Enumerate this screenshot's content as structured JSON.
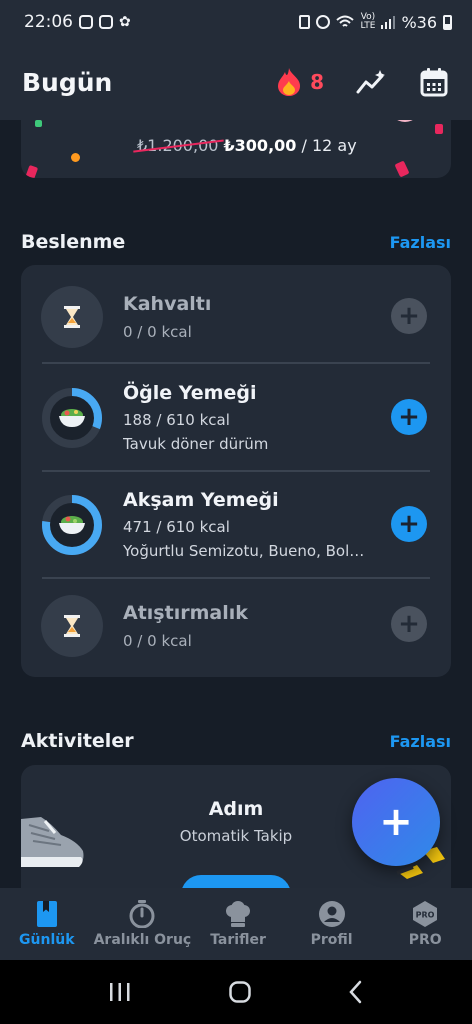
{
  "status_bar": {
    "time": "22:06",
    "battery_text": "%36"
  },
  "header": {
    "title": "Bugün",
    "streak_count": "8"
  },
  "promo": {
    "old_price": "₺1.200,00",
    "new_price": "₺300,00",
    "period": " / 12 ay"
  },
  "nutrition": {
    "title": "Beslenme",
    "more_link": "Fazlası",
    "meals": [
      {
        "name": "Kahvaltı",
        "kcal": "0 / 0 kcal",
        "detail": "",
        "icon": "hourglass-icon",
        "progress": 0
      },
      {
        "name": "Öğle Yemeği",
        "kcal": "188 / 610 kcal",
        "detail": "Tavuk döner dürüm",
        "icon": "salad-bowl-icon",
        "progress": 0.31
      },
      {
        "name": "Akşam Yemeği",
        "kcal": "471 / 610 kcal",
        "detail": "Yoğurtlu Semizotu, Bueno, Bolo…",
        "icon": "salad-bowl-icon",
        "progress": 0.77
      },
      {
        "name": "Atıştırmalık",
        "kcal": "0 / 0 kcal",
        "detail": "",
        "icon": "hourglass-icon",
        "progress": 0
      }
    ]
  },
  "activities": {
    "title": "Aktiviteler",
    "more_link": "Fazlası",
    "card_title": "Adım",
    "card_subtitle": "Otomatik Takip"
  },
  "bottom_nav": {
    "items": [
      {
        "label": "Günlük",
        "icon": "diary-icon",
        "active": true
      },
      {
        "label": "Aralıklı Oruç",
        "icon": "stopwatch-icon",
        "active": false
      },
      {
        "label": "Tarifler",
        "icon": "chef-hat-icon",
        "active": false
      },
      {
        "label": "Profil",
        "icon": "profile-icon",
        "active": false
      },
      {
        "label": "PRO",
        "icon": "pro-badge-icon",
        "active": false
      }
    ]
  },
  "colors": {
    "accent": "#1d97f1",
    "streak": "#ff4a5c",
    "background": "#161d27",
    "card": "#232b37"
  }
}
